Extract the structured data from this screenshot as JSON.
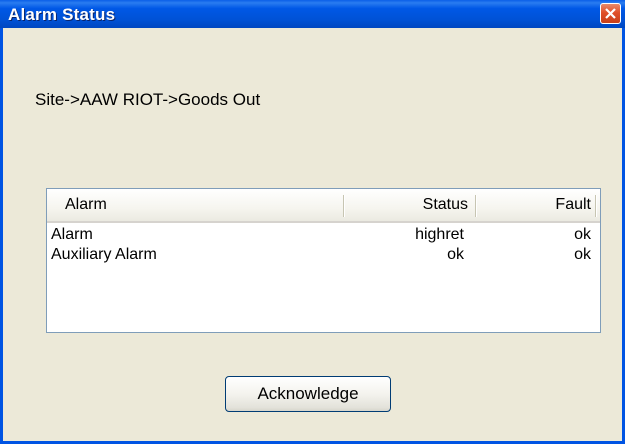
{
  "window": {
    "title": "Alarm Status",
    "close_icon": "close-x-icon"
  },
  "path": "Site->AAW RIOT->Goods Out",
  "list": {
    "columns": [
      "Alarm",
      "Status",
      "Fault"
    ],
    "rows": [
      {
        "alarm": "Alarm",
        "status": "highret",
        "fault": "ok"
      },
      {
        "alarm": "Auxiliary Alarm",
        "status": "ok",
        "fault": "ok"
      }
    ]
  },
  "buttons": {
    "acknowledge": "Acknowledge"
  },
  "colors": {
    "titlebar": "#0054e3",
    "close": "#e0502a",
    "background": "#ece9d8"
  }
}
